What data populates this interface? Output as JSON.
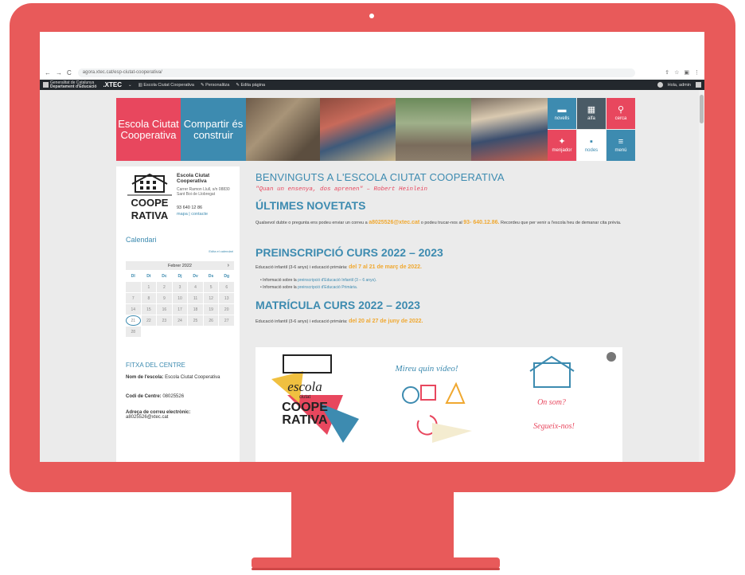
{
  "browser": {
    "url": "agora.xtec.cat/esp-ciutat-cooperativa/"
  },
  "adminbar": {
    "gencat_line1": "Generalitat de Catalunya",
    "gencat_line2": "Departament d'Educació",
    "xtec": ".XTEC",
    "site": "Escola Ciutat Cooperativa",
    "customize": "Personalitza",
    "edit": "Edita pàgina",
    "greeting": "Hola, admin"
  },
  "header": {
    "tile1": "Escola Ciutat Cooperativa",
    "tile2": "Compartir és construir",
    "icons": [
      {
        "label": "novells",
        "glyph": "▬"
      },
      {
        "label": "alfa",
        "glyph": "▦"
      },
      {
        "label": "cerca",
        "glyph": "⚲"
      },
      {
        "label": "menjador",
        "glyph": "✦"
      },
      {
        "label": "nodes",
        "glyph": "▪"
      },
      {
        "label": "menú",
        "glyph": "≡"
      }
    ]
  },
  "sidebar": {
    "school_name": "Escola Ciutat Cooperativa",
    "address": "Carrer Ramon Llull, s/n 08830 Sant Boi de Llobregat",
    "phone": "93 640 12 86",
    "links": "mapa | contacte",
    "calendar_title": "Calendari",
    "calendar_sub": "Edita el calendari",
    "calendar_month": "Febrer 2022",
    "calendar_next": "›",
    "weekdays": [
      "Dl",
      "Dt",
      "Dc",
      "Dj",
      "Dv",
      "Ds",
      "Dg"
    ],
    "days": [
      "",
      "1",
      "2",
      "3",
      "4",
      "5",
      "6",
      "7",
      "8",
      "9",
      "10",
      "11",
      "12",
      "13",
      "14",
      "15",
      "16",
      "17",
      "18",
      "19",
      "20",
      "21",
      "22",
      "23",
      "24",
      "25",
      "26",
      "27",
      "28"
    ],
    "fitxa_title": "FITXA DEL CENTRE",
    "nom_label": "Nom de l'escola:",
    "nom_value": "Escola Ciutat Cooperativa",
    "codi_label": "Codi de Centre:",
    "codi_value": "08025526",
    "email_label": "Adreça de correu electrònic:",
    "email_value": "a8025526@xtec.cat"
  },
  "main": {
    "welcome": "BENVINGUTS A L'ESCOLA CIUTAT COOPERATIVA",
    "quote": "\"Quan un ensenya, dos aprenen\" – Robert Heinlein",
    "novetats_title": "ÚLTIMES NOVETATS",
    "novetats_text_a": "Qualsevol dubte o pregunta ens podeu enviar un correu a",
    "novetats_email": "a8025526@xtec.cat",
    "novetats_text_b": "o podeu trucar-nos al",
    "novetats_phone": "93- 640.12.86.",
    "novetats_text_c": "Recordeu que per venir a l'escola heu de demanar cita prèvia.",
    "preins_title": "PREINSCRIPCIÓ CURS 2022 – 2023",
    "preins_text": "Educació infantil (3-6 anys) i educació primària:",
    "preins_dates": "del 7 al 21 de març de 2022.",
    "bullet1_a": "Informació sobre la",
    "bullet1_link": "preinscripció d'Educació Infantil (3 – 6 anys).",
    "bullet2_a": "Informació sobre la",
    "bullet2_link": "preinscripció d'Educació Primària.",
    "matricula_title": "MATRÍCULA CURS 2022 – 2023",
    "matricula_text": "Educació infantil (3-6 anys) i educació primària:",
    "matricula_dates": "del 20 al 27 de juny de 2022.",
    "card_logo_line1": "escola",
    "card_logo_line2": "ciutat",
    "card_logo_line3": "COOPE",
    "card_logo_line4": "RATIVA",
    "card_mid": "Mireu quin vídeo!",
    "card_right1": "On som?",
    "card_right2": "Segueix-nos!"
  }
}
